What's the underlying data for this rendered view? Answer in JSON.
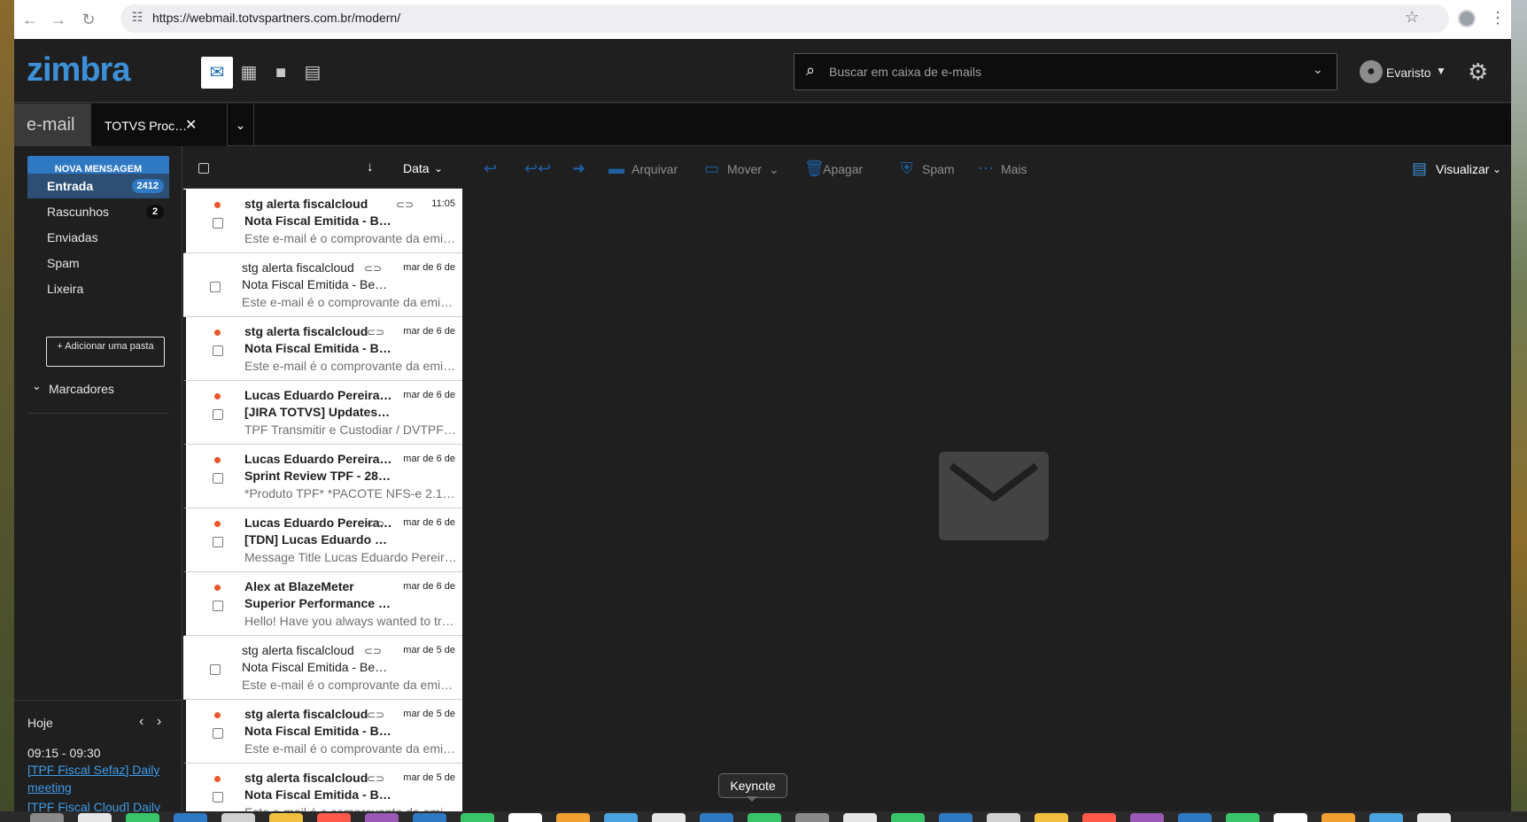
{
  "browser": {
    "url": "https://webmail.totvspartners.com.br/modern/",
    "back_icon": "arrow-left-icon",
    "forward_icon": "arrow-right-icon",
    "reload_icon": "reload-icon"
  },
  "app": {
    "logo_text": "zimbra",
    "accent_color": "#2f78c4"
  },
  "search": {
    "placeholder": "Buscar em caixa de e-mails"
  },
  "user": {
    "name": "Evaristo"
  },
  "tabs": {
    "email": "e-mail",
    "doc": "TOTVS Proc…"
  },
  "sidebar": {
    "new_message": "NOVA MENSAGEM",
    "folders": [
      {
        "label": "Entrada",
        "count": "2412"
      },
      {
        "label": "Rascunhos",
        "count": "2"
      },
      {
        "label": "Enviadas"
      },
      {
        "label": "Spam"
      },
      {
        "label": "Lixeira"
      }
    ],
    "add_folder": "+ Adicionar uma pasta",
    "labels_title": "Marcadores",
    "today": "Hoje",
    "appt_time": "09:15 - 09:30",
    "appts": [
      "[TPF Fiscal Sefaz] Daily meeting",
      "[TPF Fiscal Cloud] Daily"
    ]
  },
  "list": {
    "sort_label": "Data",
    "rows": [
      {
        "sender": "stg alerta fiscalcloud",
        "subject": "Nota Fiscal Emitida - Be…",
        "preview": "Este e-mail é o comprovante da emis…",
        "date": "11:05",
        "unread": true,
        "clip": true
      },
      {
        "sender": "stg alerta fiscalcloud",
        "subject": "Nota Fiscal Emitida - Bem…",
        "preview": "Este e-mail é o comprovante da emis…",
        "date": "mar de 6 de",
        "unread": false,
        "clip": true
      },
      {
        "sender": "stg alerta fiscalcloud",
        "subject": "Nota Fiscal Emitida - Be…",
        "preview": "Este e-mail é o comprovante da emis…",
        "date": "mar de 6 de",
        "unread": true,
        "clip": true
      },
      {
        "sender": "Lucas Eduardo Pereira Fra…",
        "subject": "[JIRA TOTVS] Updates fo…",
        "preview": "TPF Transmitir e Custodiar / DVTPFT…",
        "date": "mar de 6 de",
        "unread": true,
        "clip": false
      },
      {
        "sender": "Lucas Eduardo Pereira Fra…",
        "subject": "Sprint Review TPF - 28 d…",
        "preview": "*Produto TPF* *PACOTE NFS-e 2.14.…",
        "date": "mar de 6 de",
        "unread": true,
        "clip": false
      },
      {
        "sender": "Lucas Eduardo Pereira …",
        "subject": "[TDN] Lucas Eduardo Per…",
        "preview": "Message Title Lucas Eduardo Pereira…",
        "date": "mar de 6 de",
        "unread": true,
        "clip": true
      },
      {
        "sender": "Alex at BlazeMeter",
        "subject": "Superior Performance Te…",
        "preview": "Hello! Have you always wanted to try …",
        "date": "mar de 6 de",
        "unread": true,
        "clip": false
      },
      {
        "sender": "stg alerta fiscalcloud",
        "subject": "Nota Fiscal Emitida - Bem…",
        "preview": "Este e-mail é o comprovante da emis…",
        "date": "mar de 5 de",
        "unread": false,
        "clip": true
      },
      {
        "sender": "stg alerta fiscalcloud",
        "subject": "Nota Fiscal Emitida - Be…",
        "preview": "Este e-mail é o comprovante da emis…",
        "date": "mar de 5 de",
        "unread": true,
        "clip": true
      },
      {
        "sender": "stg alerta fiscalcloud",
        "subject": "Nota Fiscal Emitida - Be…",
        "preview": "Este e-mail é o comprovante da emis…",
        "date": "mar de 5 de",
        "unread": true,
        "clip": true
      }
    ]
  },
  "toolbar": {
    "archive": "Arquivar",
    "move": "Mover",
    "delete": "Apagar",
    "spam": "Spam",
    "more": "Mais",
    "view": "Visualizar"
  },
  "tooltip": {
    "text": "Keynote"
  }
}
